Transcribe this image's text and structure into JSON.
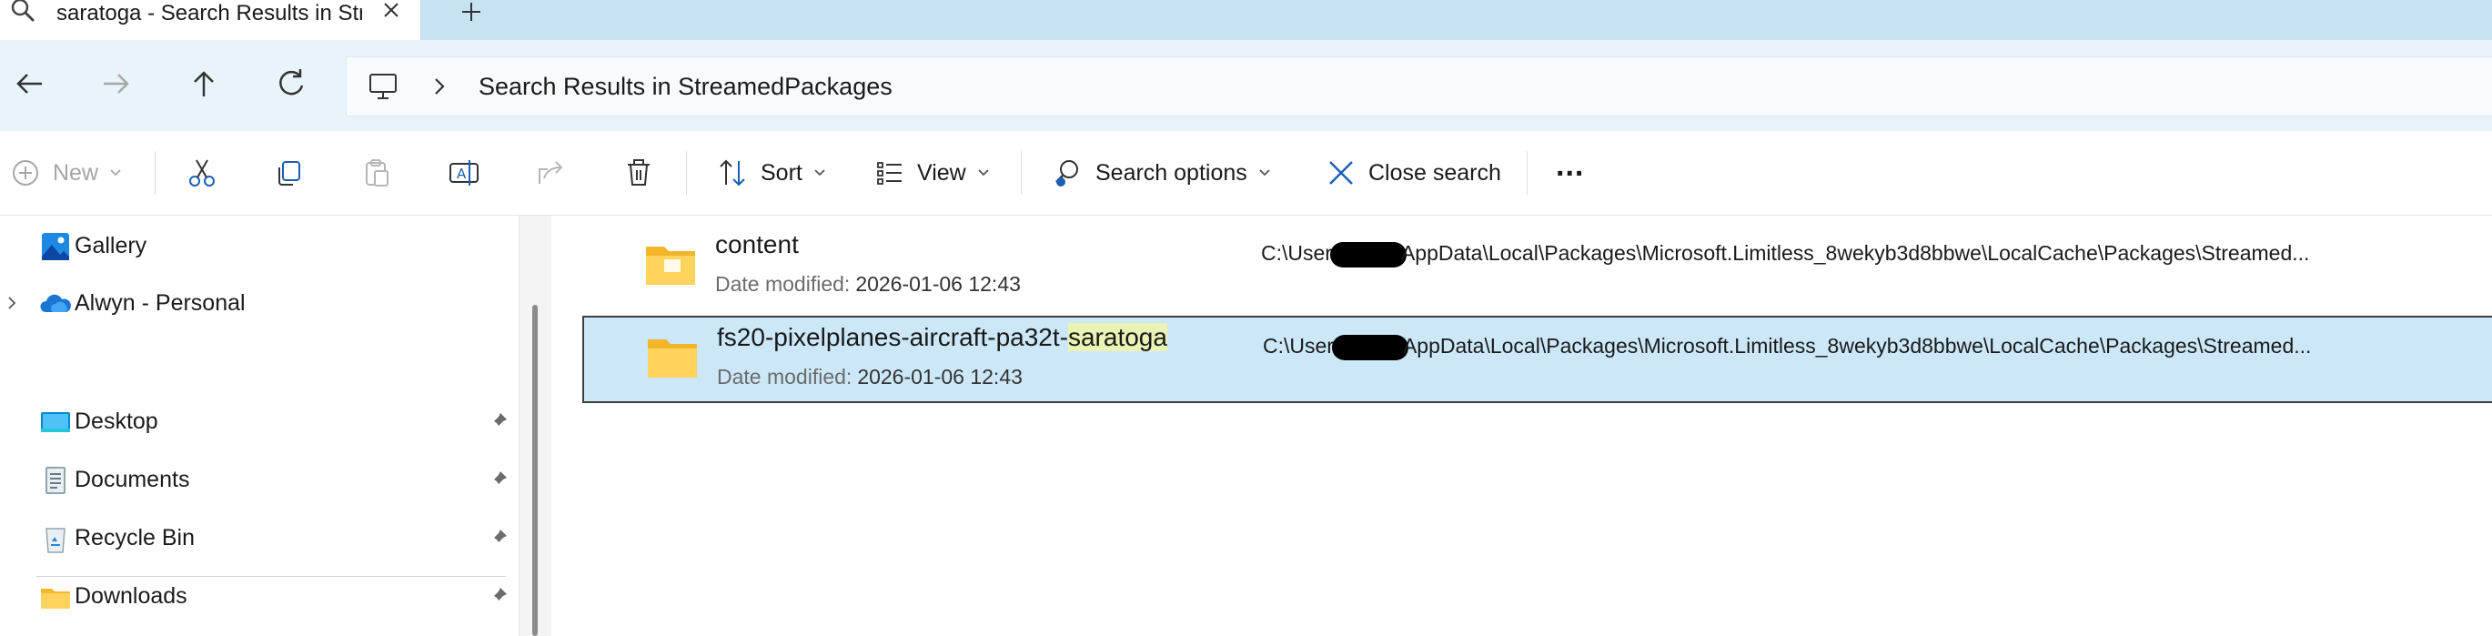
{
  "tab": {
    "title": "saratoga - Search Results in StreamedPackages",
    "icon": "search-icon"
  },
  "address": {
    "location_icon": "this-pc-icon",
    "breadcrumb": "Search Results in StreamedPackages"
  },
  "commands": {
    "new_label": "New",
    "sort_label": "Sort",
    "view_label": "View",
    "search_options_label": "Search options",
    "close_search_label": "Close search",
    "more_label": "..."
  },
  "sidebar": {
    "items": [
      {
        "label": "Gallery",
        "icon": "gallery-icon"
      },
      {
        "label": "Alwyn - Personal",
        "icon": "onedrive-icon"
      },
      {
        "label": "Desktop",
        "icon": "desktop-icon",
        "pinned": true
      },
      {
        "label": "Documents",
        "icon": "documents-icon",
        "pinned": true
      },
      {
        "label": "Recycle Bin",
        "icon": "recycle-bin-icon",
        "pinned": true
      },
      {
        "label": "Downloads",
        "icon": "downloads-icon",
        "pinned": true
      }
    ]
  },
  "results": [
    {
      "name": "content",
      "meta_label": "Date modified:",
      "meta_value": "2026-01-06 12:43",
      "path_prefix": "C:\\User",
      "path_suffix": "AppData\\Local\\Packages\\Microsoft.Limitless_8wekyb3d8bbwe\\LocalCache\\Packages\\Streamed...",
      "selected": false
    },
    {
      "name_prefix": "fs20-pixelplanes-aircraft-pa32t-",
      "name_highlight": "saratoga",
      "meta_label": "Date modified:",
      "meta_value": "2026-01-06 12:43",
      "path_prefix": "C:\\User",
      "path_suffix": "AppData\\Local\\Packages\\Microsoft.Limitless_8wekyb3d8bbwe\\LocalCache\\Packages\\Streamed...",
      "selected": true
    }
  ],
  "colors": {
    "accent": "#0f6cbd",
    "selection": "#cce8f8",
    "highlight": "#e9f3b3",
    "folder": "#f7c64a"
  }
}
